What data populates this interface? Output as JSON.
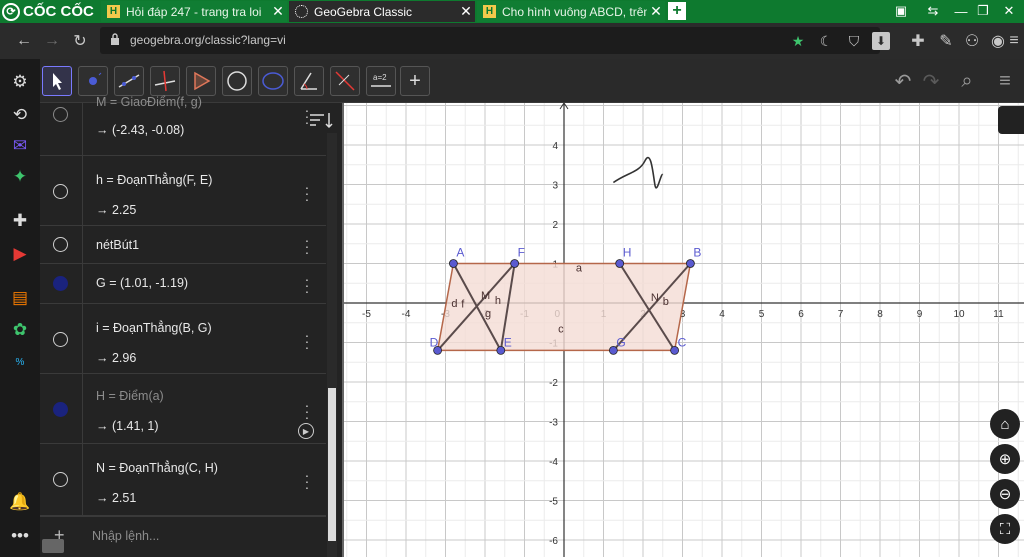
{
  "browser": {
    "brand": "CỐC CỐC",
    "tabs": [
      {
        "title": "Hỏi đáp 247 - trang tra loi",
        "favicon": "h-favicon",
        "active": false
      },
      {
        "title": "GeoGebra Classic",
        "favicon": "geogebra-favicon",
        "active": true
      },
      {
        "title": "Cho hình vuông ABCD, trên c",
        "favicon": "h-favicon",
        "active": false
      }
    ],
    "url": "geogebra.org/classic?lang=vi"
  },
  "toolbar": {
    "tools": [
      "move-tool",
      "point-tool",
      "line-tool",
      "perpendicular-tool",
      "polygon-tool",
      "circle-tool",
      "ellipse-tool",
      "angle-tool",
      "reflect-tool",
      "slider-tool",
      "add-tool"
    ],
    "slider_label": "a=2"
  },
  "algebra": {
    "rows": [
      {
        "definition": "M = GiaoĐiểm(f, g)",
        "value": "→ (-2.43, -0.08)",
        "marble": "dim",
        "def_dim": true
      },
      {
        "definition": "h = ĐoạnThẳng(F, E)",
        "value": "→ 2.25",
        "marble": "empty",
        "def_dim": false
      },
      {
        "definition": "nétBút1",
        "value": "",
        "marble": "empty",
        "def_dim": false
      },
      {
        "definition": "G = (1.01, -1.19)",
        "value": "",
        "marble": "filled",
        "def_dim": false
      },
      {
        "definition": "i = ĐoạnThẳng(B, G)",
        "value": "→ 2.96",
        "marble": "empty",
        "def_dim": false
      },
      {
        "definition": "H = Điểm(a)",
        "value": "→ (1.41, 1)",
        "marble": "filled",
        "def_dim": true
      },
      {
        "definition": "N = ĐoạnThẳng(C, H)",
        "value": "→ 2.51",
        "marble": "empty",
        "def_dim": false
      }
    ],
    "input_placeholder": "Nhập lệnh..."
  },
  "graph": {
    "x_ticks": [
      "-5",
      "-4",
      "-3",
      "-2",
      "-1",
      "1",
      "2",
      "3",
      "4",
      "5",
      "6",
      "7",
      "8",
      "9",
      "10",
      "11"
    ],
    "y_ticks": [
      "4",
      "3",
      "2",
      "1",
      "-1",
      "-2",
      "-3",
      "-4",
      "-5",
      "-6"
    ],
    "origin_label": "0",
    "points": [
      {
        "name": "A",
        "x": -2.8,
        "y": 1
      },
      {
        "name": "F",
        "x": -1.25,
        "y": 1
      },
      {
        "name": "H",
        "x": 1.41,
        "y": 1
      },
      {
        "name": "B",
        "x": 3.2,
        "y": 1
      },
      {
        "name": "D",
        "x": -3.2,
        "y": -1.2
      },
      {
        "name": "E",
        "x": -1.6,
        "y": -1.2
      },
      {
        "name": "G",
        "x": 1.25,
        "y": -1.2
      },
      {
        "name": "C",
        "x": 2.8,
        "y": -1.2
      }
    ],
    "labels": [
      {
        "text": "a",
        "x": 0.3,
        "y": 0.8
      },
      {
        "text": "c",
        "x": -0.15,
        "y": -0.75
      },
      {
        "text": "d",
        "x": -2.85,
        "y": -0.1
      },
      {
        "text": "f",
        "x": -2.6,
        "y": -0.12
      },
      {
        "text": "M",
        "x": -2.1,
        "y": 0.1
      },
      {
        "text": "h",
        "x": -1.75,
        "y": -0.02
      },
      {
        "text": "g",
        "x": -2.0,
        "y": -0.35
      },
      {
        "text": "N",
        "x": 2.2,
        "y": 0.05
      },
      {
        "text": "b",
        "x": 2.5,
        "y": -0.05
      }
    ],
    "colors": {
      "polygon_fill": "#f4dcd4",
      "polygon_edge": "#b5674a",
      "point": "#5a5ad0",
      "segment": "#5a4b4b",
      "grid_major": "#c8c8c8",
      "grid_minor": "#ebebeb"
    }
  }
}
